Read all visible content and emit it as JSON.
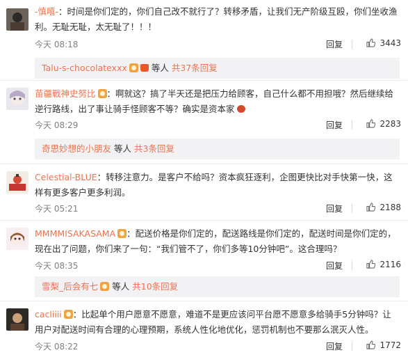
{
  "comments": [
    {
      "user": "-慎嘻-",
      "text": "：时间是你们定的，你们自己改不就行了？转移矛盾，让我们无产阶级互殴，你们坐收渔利。无耻无耻，太无耻了！！！",
      "time": "今天 08:18",
      "reply": "回复",
      "likes": "3443",
      "sub": {
        "user": "Talu-s-chocolatexxx",
        "text": "等人",
        "count": "共37条回复"
      }
    },
    {
      "user": "苗疆戰神史努比",
      "text": "：啊就这？搞了半天还是把压力给顾客，自己什么都不用担哦？然后继续给逆行路线，出了事让骑手怪顾客不等？确实是资本家",
      "time": "今天 08:29",
      "reply": "回复",
      "likes": "2283",
      "sub": {
        "user": "奇思妙想的小朋友",
        "text": "等人",
        "count": "共3条回复"
      }
    },
    {
      "user": "Celestial-BLUE",
      "text": "：转移注意力。是客户不给吗？资本疯狂逐利，企图更快比对手快第一快，这样有更多客户更多利润。",
      "time": "今天 05:21",
      "reply": "回复",
      "likes": "2188"
    },
    {
      "user": "MMMMISAKASAMA",
      "text": "：配送价格是你们定的，配送路线是你们定的，配送时间是你们定的，现在出了问题，你们来了一句：“我们管不了，你们多等10分钟吧”。这合理吗？",
      "time": "今天 08:35",
      "reply": "回复",
      "likes": "2116",
      "sub": {
        "user": "雪梨_后会有七",
        "text": "等人",
        "count": "共10条回复"
      }
    },
    {
      "user": "cacliiii",
      "text": "：比起单个用户愿意不愿意，难道不是更应该问平台愿不愿意多给骑手5分钟吗？让用户对配送时间有合理的心理预期，系统人性化地优化，惩罚机制也不要那么泯灭人性。",
      "time": "今天 08:22",
      "reply": "回复",
      "likes": "1772"
    }
  ]
}
